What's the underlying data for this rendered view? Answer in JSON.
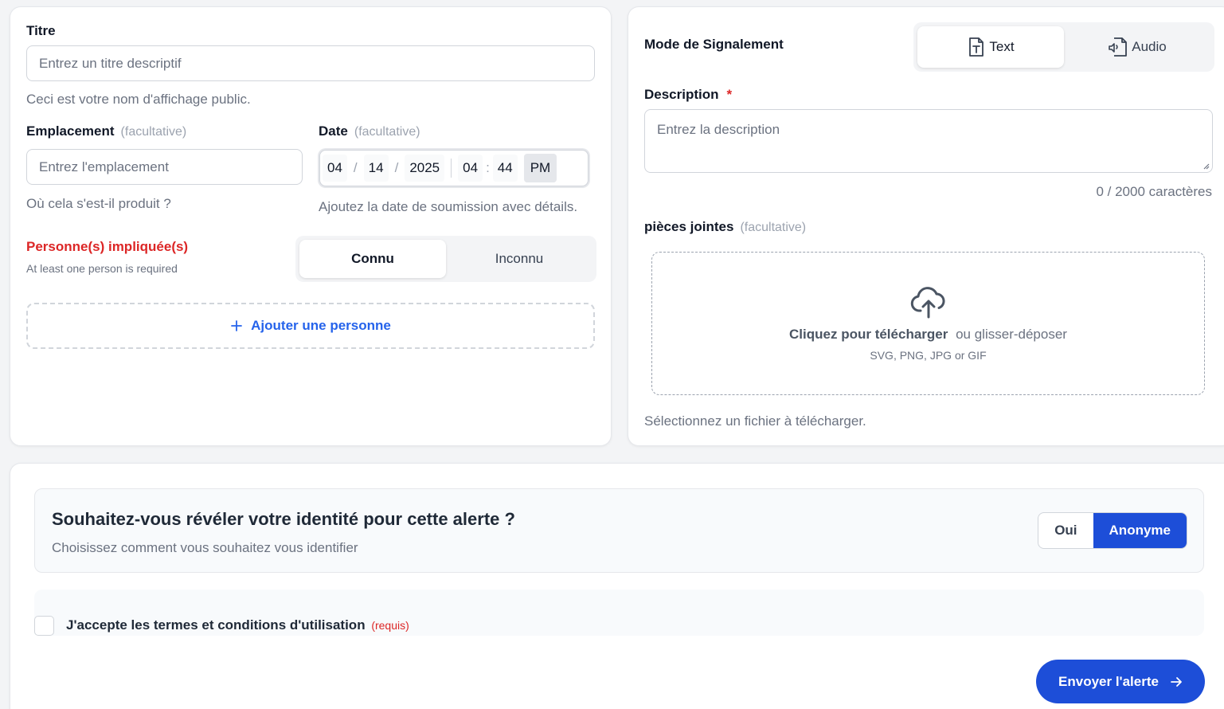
{
  "left_card": {
    "title_label": "Titre",
    "title_placeholder": "Entrez un titre descriptif",
    "title_help": "Ceci est votre nom d'affichage public.",
    "location_label": "Emplacement",
    "location_optional": "(facultative)",
    "location_placeholder": "Entrez l'emplacement",
    "location_help": "Où cela s'est-il produit ?",
    "date_label": "Date",
    "date_optional": "(facultative)",
    "date": {
      "month": "04",
      "day": "14",
      "year": "2025",
      "hour": "04",
      "minute": "44",
      "ampm": "PM",
      "sep1": "/",
      "sep2": "/",
      "sep3": ":"
    },
    "date_help": "Ajoutez la date de soumission avec détails.",
    "persons_label": "Personne(s) impliquée(s)",
    "persons_error": "At least one person is required",
    "toggle_known": "Connu",
    "toggle_unknown": "Inconnu",
    "add_person": "Ajouter une personne"
  },
  "right_card": {
    "mode_label": "Mode de Signalement",
    "mode_text": "Text",
    "mode_audio": "Audio",
    "description_label": "Description",
    "required_mark": "*",
    "description_placeholder": "Entrez la description",
    "char_count": "0 / 2000 caractères",
    "attachments_label": "pièces jointes",
    "attachments_optional": "(facultative)",
    "upload_click": "Cliquez pour télécharger",
    "upload_drag": "ou glisser-déposer",
    "upload_types": "SVG, PNG, JPG or GIF",
    "upload_help": "Sélectionnez un fichier à télécharger."
  },
  "bottom_card": {
    "identity_question": "Souhaitez-vous révéler votre identité pour cette alerte ?",
    "identity_sub": "Choisissez comment vous souhaitez vous identifier",
    "option_yes": "Oui",
    "option_anon": "Anonyme",
    "terms_label": "J'accepte les termes et conditions d'utilisation",
    "terms_required": "(requis)",
    "submit": "Envoyer l'alerte"
  },
  "colors": {
    "accent": "#1d4ed8",
    "link": "#2563eb",
    "error": "#dc2626"
  },
  "icons": [
    "file-text-icon",
    "file-audio-icon",
    "plus-icon",
    "upload-cloud-icon",
    "arrow-right-icon"
  ]
}
